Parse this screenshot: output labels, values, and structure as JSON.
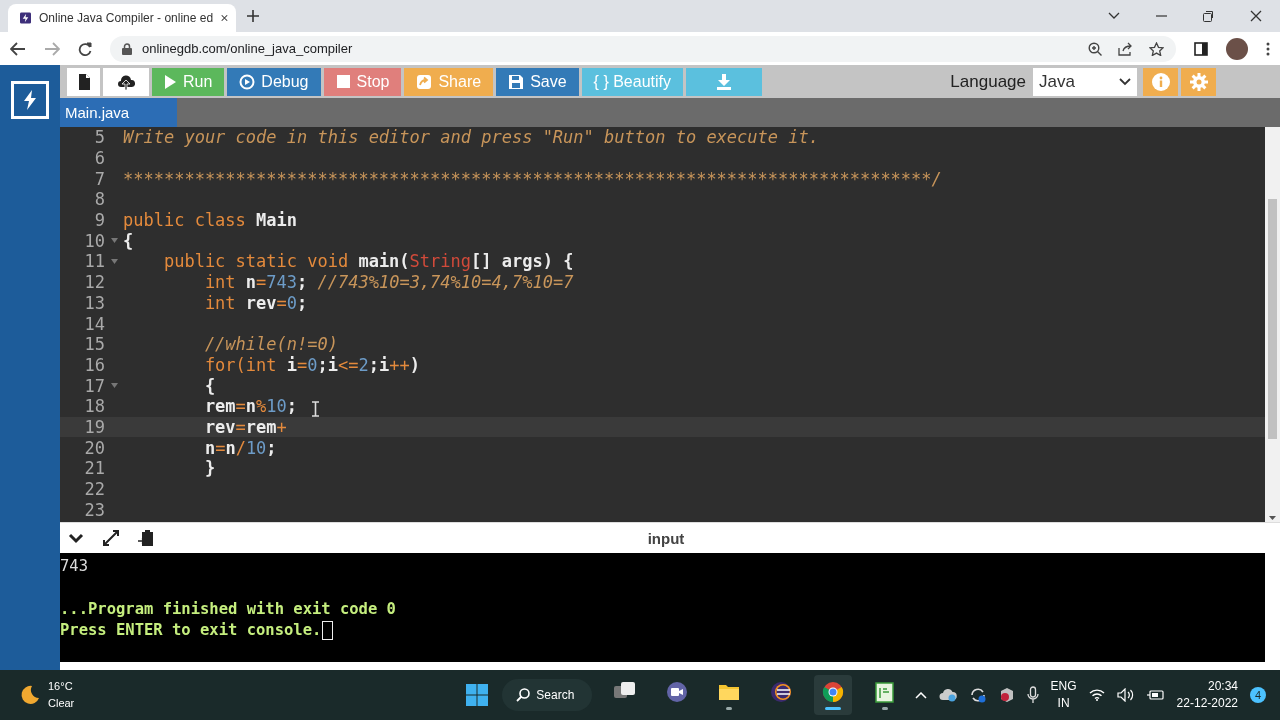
{
  "browser": {
    "tab": {
      "title": "Online Java Compiler - online ed",
      "selected": true
    },
    "url": "onlinegdb.com/online_java_compiler"
  },
  "toolbar": {
    "buttons": [
      {
        "kind": "new-file",
        "color": "#ffffff"
      },
      {
        "kind": "upload",
        "color": "#ffffff"
      },
      {
        "kind": "run",
        "label": "Run",
        "color": "#5cb85c"
      },
      {
        "kind": "debug",
        "label": "Debug",
        "color": "#337ab7"
      },
      {
        "kind": "stop",
        "label": "Stop",
        "color": "#e07f7c"
      },
      {
        "kind": "share",
        "label": "Share",
        "color": "#f0ad4e"
      },
      {
        "kind": "save",
        "label": "Save",
        "color": "#337ab7"
      },
      {
        "kind": "beautify",
        "label": "{ } Beautify",
        "color": "#5bc0de"
      },
      {
        "kind": "download",
        "color": "#5bc0de"
      }
    ],
    "language_label": "Language",
    "language": "Java"
  },
  "file_tabs": [
    {
      "label": "Main.java",
      "selected": true
    }
  ],
  "editor": {
    "lines": [
      {
        "number": "5",
        "foldable": false,
        "active": false,
        "tokens": [
          {
            "kind": "comment",
            "text": "Write your code in this editor and press \"Run\" button to execute it."
          }
        ]
      },
      {
        "number": "6",
        "foldable": false,
        "active": false
      },
      {
        "number": "7",
        "foldable": false,
        "active": false,
        "tokens": [
          {
            "kind": "comment",
            "text": "*******************************************************************************/"
          }
        ]
      },
      {
        "number": "8",
        "foldable": false,
        "active": false
      },
      {
        "number": "9",
        "foldable": false,
        "active": false,
        "tokens": [
          {
            "kind": "keyword",
            "text": "public class "
          },
          {
            "kind": "name",
            "text": "Main"
          }
        ]
      },
      {
        "number": "10",
        "foldable": true,
        "active": false,
        "tokens": [
          {
            "kind": "name",
            "text": "{"
          }
        ]
      },
      {
        "number": "11",
        "foldable": true,
        "active": false,
        "tokens": [
          {
            "kind": "keyword",
            "text": "    public static void "
          },
          {
            "kind": "name",
            "text": "main("
          },
          {
            "kind": "type",
            "text": "String"
          },
          {
            "kind": "name",
            "text": "[] args) {"
          }
        ]
      },
      {
        "number": "12",
        "foldable": false,
        "active": false,
        "tokens": [
          {
            "kind": "keyword",
            "text": "        int "
          },
          {
            "kind": "name",
            "text": "n"
          },
          {
            "kind": "operator",
            "text": "="
          },
          {
            "kind": "number",
            "text": "743"
          },
          {
            "kind": "name",
            "text": "; "
          },
          {
            "kind": "comment",
            "text": "//743%10=3,74%10=4,7%10=7"
          }
        ]
      },
      {
        "number": "13",
        "foldable": false,
        "active": false,
        "tokens": [
          {
            "kind": "keyword",
            "text": "        int "
          },
          {
            "kind": "name",
            "text": "rev"
          },
          {
            "kind": "operator",
            "text": "="
          },
          {
            "kind": "number",
            "text": "0"
          },
          {
            "kind": "name",
            "text": ";"
          }
        ]
      },
      {
        "number": "14",
        "foldable": false,
        "active": false
      },
      {
        "number": "15",
        "foldable": false,
        "active": false,
        "tokens": [
          {
            "kind": "comment",
            "text": "        //while(n!=0)"
          }
        ]
      },
      {
        "number": "16",
        "foldable": false,
        "active": false,
        "tokens": [
          {
            "kind": "keyword",
            "text": "        for(int "
          },
          {
            "kind": "name",
            "text": "i"
          },
          {
            "kind": "operator",
            "text": "="
          },
          {
            "kind": "number",
            "text": "0"
          },
          {
            "kind": "name",
            "text": ";i"
          },
          {
            "kind": "operator",
            "text": "<="
          },
          {
            "kind": "number",
            "text": "2"
          },
          {
            "kind": "name",
            "text": ";i"
          },
          {
            "kind": "operator",
            "text": "++"
          },
          {
            "kind": "name",
            "text": ")"
          }
        ]
      },
      {
        "number": "17",
        "foldable": true,
        "active": false,
        "tokens": [
          {
            "kind": "name",
            "text": "        {"
          }
        ]
      },
      {
        "number": "18",
        "foldable": false,
        "active": false,
        "tokens": [
          {
            "kind": "name",
            "text": "        rem"
          },
          {
            "kind": "operator",
            "text": "="
          },
          {
            "kind": "name",
            "text": "n"
          },
          {
            "kind": "operator",
            "text": "%"
          },
          {
            "kind": "number",
            "text": "10"
          },
          {
            "kind": "name",
            "text": ";"
          }
        ]
      },
      {
        "number": "19",
        "foldable": false,
        "active": true,
        "tokens": [
          {
            "kind": "name",
            "text": "        rev"
          },
          {
            "kind": "operator",
            "text": "="
          },
          {
            "kind": "name",
            "text": "rem"
          },
          {
            "kind": "operator",
            "text": "+"
          }
        ]
      },
      {
        "number": "20",
        "foldable": false,
        "active": false,
        "tokens": [
          {
            "kind": "name",
            "text": "        n"
          },
          {
            "kind": "operator",
            "text": "="
          },
          {
            "kind": "name",
            "text": "n"
          },
          {
            "kind": "operator",
            "text": "/"
          },
          {
            "kind": "number",
            "text": "10"
          },
          {
            "kind": "name",
            "text": ";"
          }
        ]
      },
      {
        "number": "21",
        "foldable": false,
        "active": false,
        "tokens": [
          {
            "kind": "name",
            "text": "        }"
          }
        ]
      },
      {
        "number": "22",
        "foldable": false,
        "active": false
      },
      {
        "number": "23",
        "foldable": false,
        "active": false
      }
    ]
  },
  "console": {
    "title": "input",
    "lines": [
      {
        "kind": "input",
        "text": "743"
      },
      {
        "kind": "blank"
      },
      {
        "kind": "message",
        "text": "...Program finished with exit code 0"
      },
      {
        "kind": "prompt",
        "text": "Press ENTER to exit console."
      }
    ]
  },
  "taskbar": {
    "weather": {
      "temperature": "16°C",
      "condition": "Clear"
    },
    "search": "Search",
    "apps": [
      {
        "kind": "task-view",
        "selected": false,
        "running": false
      },
      {
        "kind": "chat",
        "selected": false,
        "running": false
      },
      {
        "kind": "folder",
        "selected": false,
        "running": true
      },
      {
        "kind": "eclipse",
        "selected": false,
        "running": false
      },
      {
        "kind": "chrome",
        "selected": true,
        "running": true
      },
      {
        "kind": "notepad",
        "selected": false,
        "running": true
      }
    ],
    "language": "ENG",
    "region": "IN",
    "time": "20:34",
    "date": "22-12-2022",
    "notifications": "4"
  }
}
